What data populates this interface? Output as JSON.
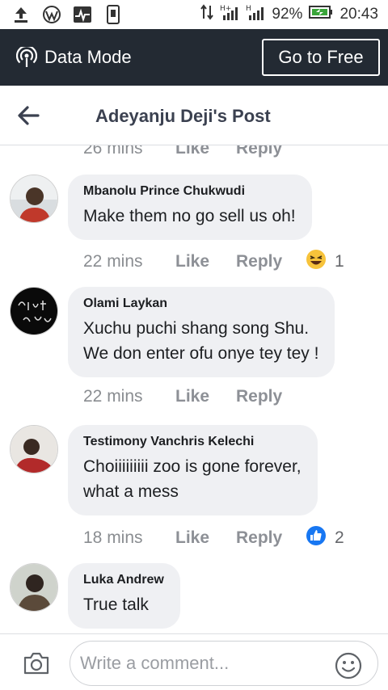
{
  "status_bar": {
    "battery": "92%",
    "time": "20:43",
    "icons": [
      "upload-icon",
      "wordpress-icon",
      "activity-icon",
      "sim-card-icon",
      "data-arrows-icon",
      "signal-h-icon",
      "signal-h-icon",
      "battery-icon"
    ]
  },
  "data_mode_bar": {
    "label": "Data Mode",
    "button": "Go to Free",
    "background": "#232a33"
  },
  "header": {
    "title": "Adeyanju Deji's Post"
  },
  "top_meta": {
    "time": "26 mins",
    "like": "Like",
    "reply": "Reply"
  },
  "comments": [
    {
      "author": "Mbanolu Prince Chukwudi",
      "text": "Make them no go sell us oh!",
      "time": "22 mins",
      "like": "Like",
      "reply": "Reply",
      "reaction": "haha",
      "reaction_count": "1"
    },
    {
      "author": "Olami Laykan",
      "text": "Xuchu puchi shang song Shu.\nWe don enter ofu onye tey tey !",
      "time": "22 mins",
      "like": "Like",
      "reply": "Reply"
    },
    {
      "author": "Testimony Vanchris Kelechi",
      "text": "Choiiiiiiiii zoo is gone forever,\nwhat a mess",
      "time": "18 mins",
      "like": "Like",
      "reply": "Reply",
      "reaction": "like",
      "reaction_count": "2"
    },
    {
      "author": "Luka Andrew",
      "text": "True talk"
    }
  ],
  "composer": {
    "placeholder": "Write a comment..."
  },
  "colors": {
    "bubble": "#eff0f3",
    "like_blue": "#1877f2",
    "haha_yellow": "#f7c33b"
  }
}
